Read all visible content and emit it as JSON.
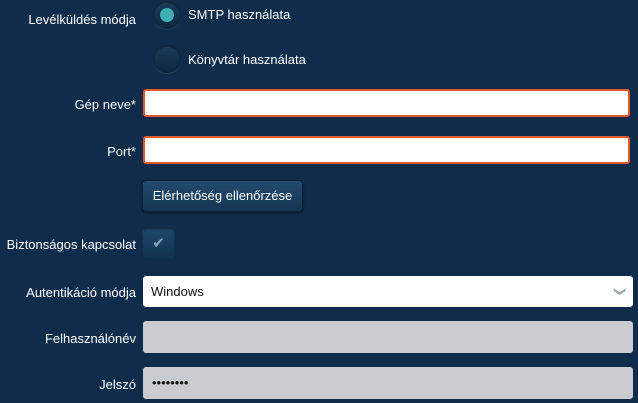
{
  "send_mode": {
    "label": "Levélküldés módja",
    "options": [
      {
        "label": "SMTP használata",
        "selected": true
      },
      {
        "label": "Könyvtár használata",
        "selected": false
      }
    ]
  },
  "host": {
    "label": "Gép neve*",
    "value": ""
  },
  "port": {
    "label": "Port*",
    "value": ""
  },
  "check_button": {
    "label": "Elérhetőség ellenőrzése"
  },
  "secure": {
    "label": "Biztonságos kapcsolat",
    "checked": true
  },
  "auth_mode": {
    "label": "Autentikáció módja",
    "value": "Windows"
  },
  "username": {
    "label": "Felhasználónév",
    "value": ""
  },
  "password": {
    "label": "Jelszó",
    "value": "••••••••"
  },
  "colors": {
    "background": "#0f2d4a",
    "accent": "#3fb0b3",
    "required_border": "#e3582b",
    "disabled_field": "#c9ccd0"
  }
}
